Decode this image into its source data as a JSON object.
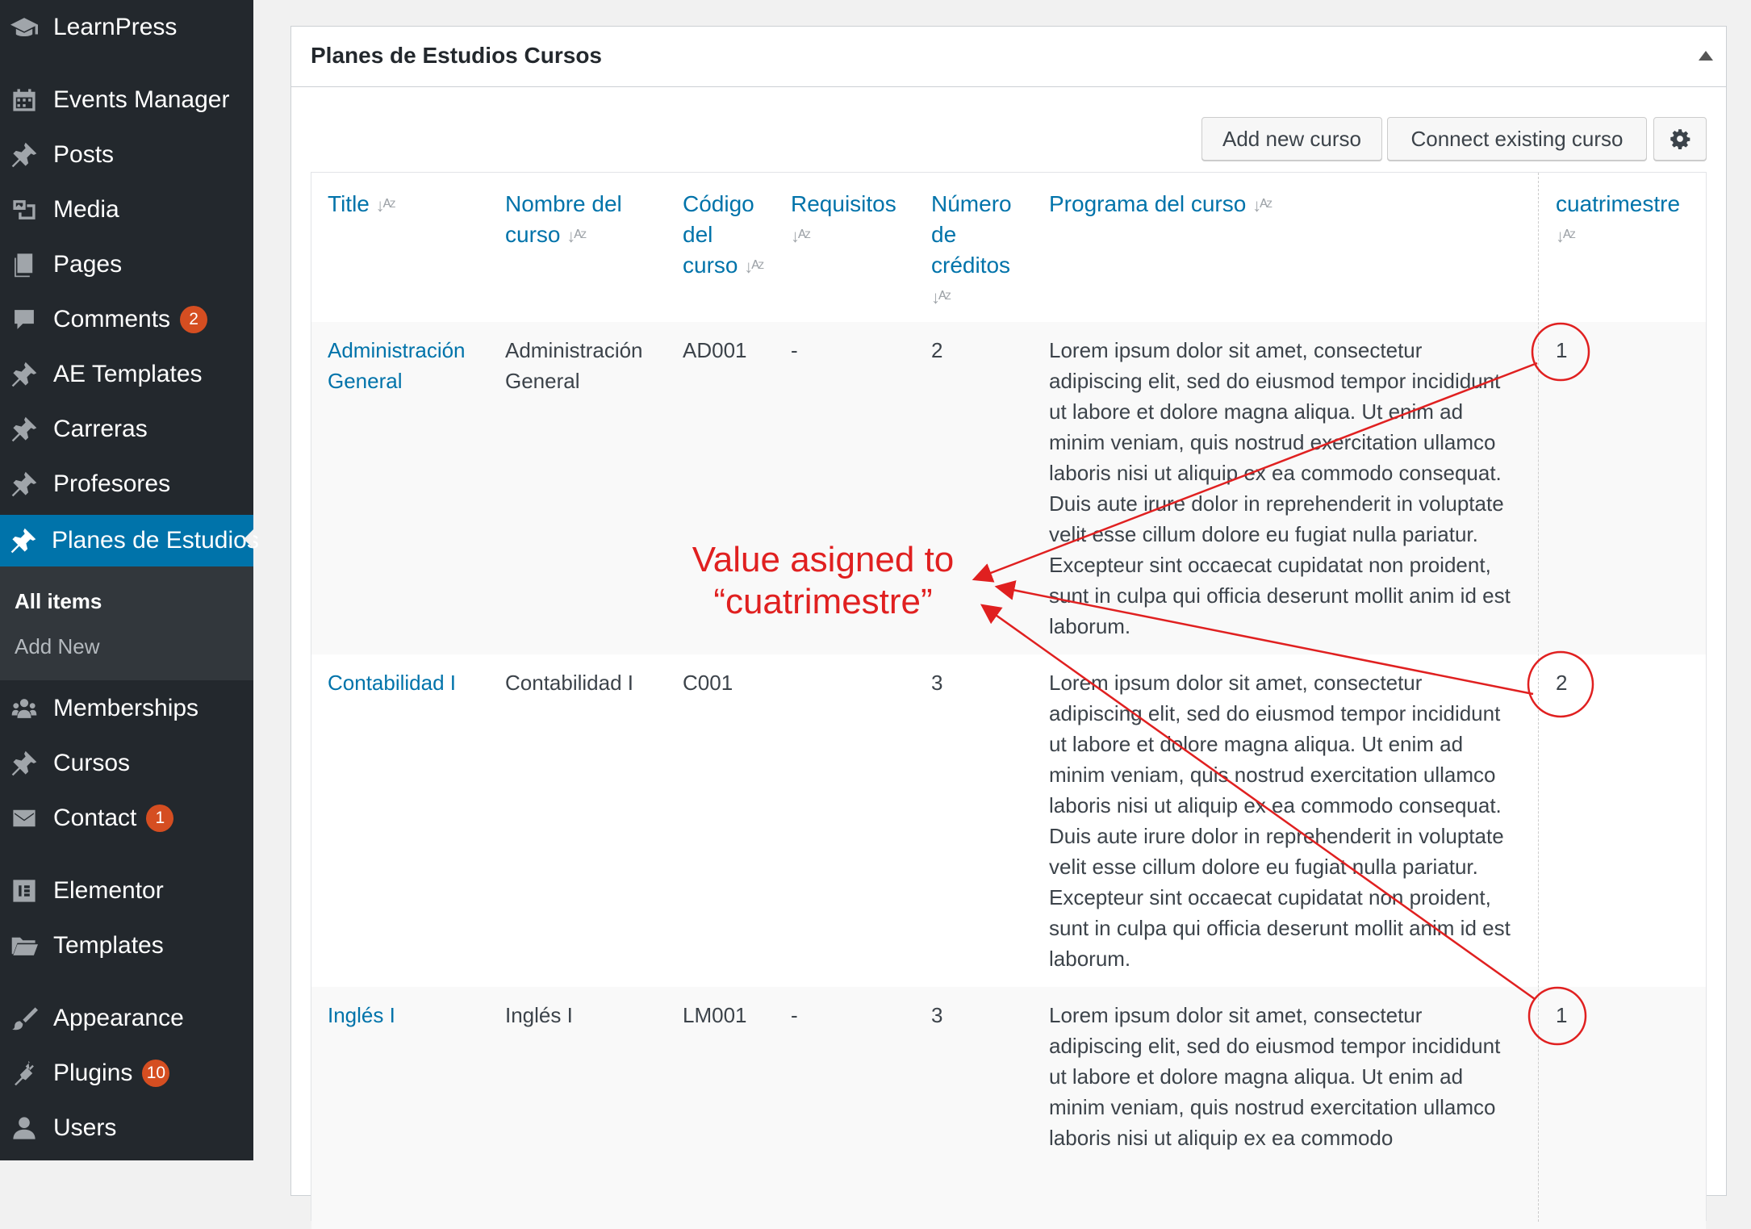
{
  "sidebar": {
    "items": [
      {
        "label": "LearnPress",
        "icon": "graduation-cap-icon"
      },
      {
        "label": "Events Manager",
        "icon": "calendar-icon"
      },
      {
        "label": "Posts",
        "icon": "pushpin-icon"
      },
      {
        "label": "Media",
        "icon": "media-icon"
      },
      {
        "label": "Pages",
        "icon": "pages-icon"
      },
      {
        "label": "Comments",
        "icon": "comment-icon",
        "badge": "2"
      },
      {
        "label": "AE Templates",
        "icon": "pushpin-icon"
      },
      {
        "label": "Carreras",
        "icon": "pushpin-icon"
      },
      {
        "label": "Profesores",
        "icon": "pushpin-icon"
      },
      {
        "label": "Planes de Estudios",
        "icon": "pushpin-icon",
        "active": true
      },
      {
        "label": "Memberships",
        "icon": "groups-icon"
      },
      {
        "label": "Cursos",
        "icon": "pushpin-icon"
      },
      {
        "label": "Contact",
        "icon": "envelope-icon",
        "badge": "1"
      },
      {
        "label": "Elementor",
        "icon": "elementor-icon"
      },
      {
        "label": "Templates",
        "icon": "folder-icon"
      },
      {
        "label": "Appearance",
        "icon": "paintbrush-icon"
      },
      {
        "label": "Plugins",
        "icon": "plugin-icon",
        "badge": "10"
      },
      {
        "label": "Users",
        "icon": "user-icon"
      }
    ],
    "submenu": [
      {
        "label": "All items",
        "current": true
      },
      {
        "label": "Add New"
      }
    ]
  },
  "panel": {
    "title": "Planes de Estudios Cursos",
    "buttons": {
      "add": "Add new curso",
      "connect": "Connect existing curso",
      "settings_icon": "gear-icon"
    }
  },
  "table": {
    "headers": [
      {
        "label": "Title",
        "sort": "↓ᴬᶻ"
      },
      {
        "label": "Nombre del curso",
        "sort": "↓ᴬᶻ"
      },
      {
        "label": "Código del curso",
        "sort": "↓ᴬᶻ"
      },
      {
        "label": "Requisitos",
        "sort": "↓ᴬᶻ"
      },
      {
        "label": "Número de créditos",
        "sort": "↓ᴬᶻ"
      },
      {
        "label": "Programa del curso",
        "sort": "↓ᴬᶻ"
      },
      {
        "label": "cuatrimestre",
        "sort": "↓ᴬᶻ"
      }
    ],
    "rows": [
      {
        "title": "Administración General",
        "nombre": "Administración General",
        "codigo": "AD001",
        "requisitos": "-",
        "creditos": "2",
        "programa": "Lorem ipsum dolor sit amet, consectetur adipiscing elit, sed do eiusmod tempor incididunt ut labore et dolore magna aliqua. Ut enim ad minim veniam, quis nostrud exercitation ullamco laboris nisi ut aliquip ex ea commodo consequat. Duis aute irure dolor in reprehenderit in voluptate velit esse cillum dolore eu fugiat nulla pariatur. Excepteur sint occaecat cupidatat non proident, sunt in culpa qui officia deserunt mollit anim id est laborum.",
        "cuatrimestre": "1"
      },
      {
        "title": "Contabilidad I",
        "nombre": "Contabilidad I",
        "codigo": "C001",
        "requisitos": "",
        "creditos": "3",
        "programa": "Lorem ipsum dolor sit amet, consectetur adipiscing elit, sed do eiusmod tempor incididunt ut labore et dolore magna aliqua. Ut enim ad minim veniam, quis nostrud exercitation ullamco laboris nisi ut aliquip ex ea commodo consequat. Duis aute irure dolor in reprehenderit in voluptate velit esse cillum dolore eu fugiat nulla pariatur. Excepteur sint occaecat cupidatat non proident, sunt in culpa qui officia deserunt mollit anim id est laborum.",
        "cuatrimestre": "2"
      },
      {
        "title": "Inglés I",
        "nombre": "Inglés I",
        "codigo": "LM001",
        "requisitos": "-",
        "creditos": "3",
        "programa": "Lorem ipsum dolor sit amet, consectetur adipiscing elit, sed do eiusmod tempor incididunt ut labore et dolore magna aliqua. Ut enim ad minim veniam, quis nostrud exercitation ullamco laboris nisi ut aliquip ex ea commodo",
        "cuatrimestre": "1"
      }
    ]
  },
  "annotation": {
    "label": "Value asigned to “cuatrimestre”",
    "color": "#e02020"
  }
}
